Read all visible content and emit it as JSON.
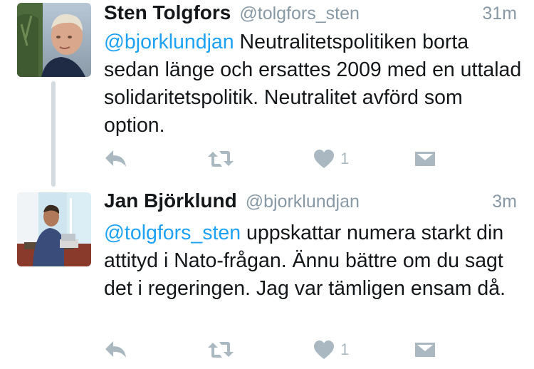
{
  "colors": {
    "name": "#14171a",
    "handle": "#8899a6",
    "mention": "#1da1f2",
    "action_icon": "#aab8c2",
    "thread_line": "#d3dbe1"
  },
  "tweets": [
    {
      "name": "Sten Tolgfors",
      "handle": "@tolgfors_sten",
      "time": "31m",
      "mention": "@bjorklundjan",
      "text": " Neutralitetspolitiken borta sedan länge och ersattes 2009 med en uttalad solidaritetspolitik. Neutralitet avförd som option.",
      "like_count": "1",
      "icons": [
        "reply-icon",
        "retweet-icon",
        "heart-icon",
        "direct-message-icon"
      ]
    },
    {
      "name": "Jan Björklund",
      "handle": "@bjorklundjan",
      "time": "3m",
      "mention": "@tolgfors_sten",
      "text": " uppskattar numera starkt din attityd i Nato-frågan. Ännu bättre om du sagt det i regeringen. Jag var tämligen ensam då.",
      "like_count": "1",
      "icons": [
        "reply-icon",
        "retweet-icon",
        "heart-icon",
        "direct-message-icon"
      ]
    }
  ]
}
